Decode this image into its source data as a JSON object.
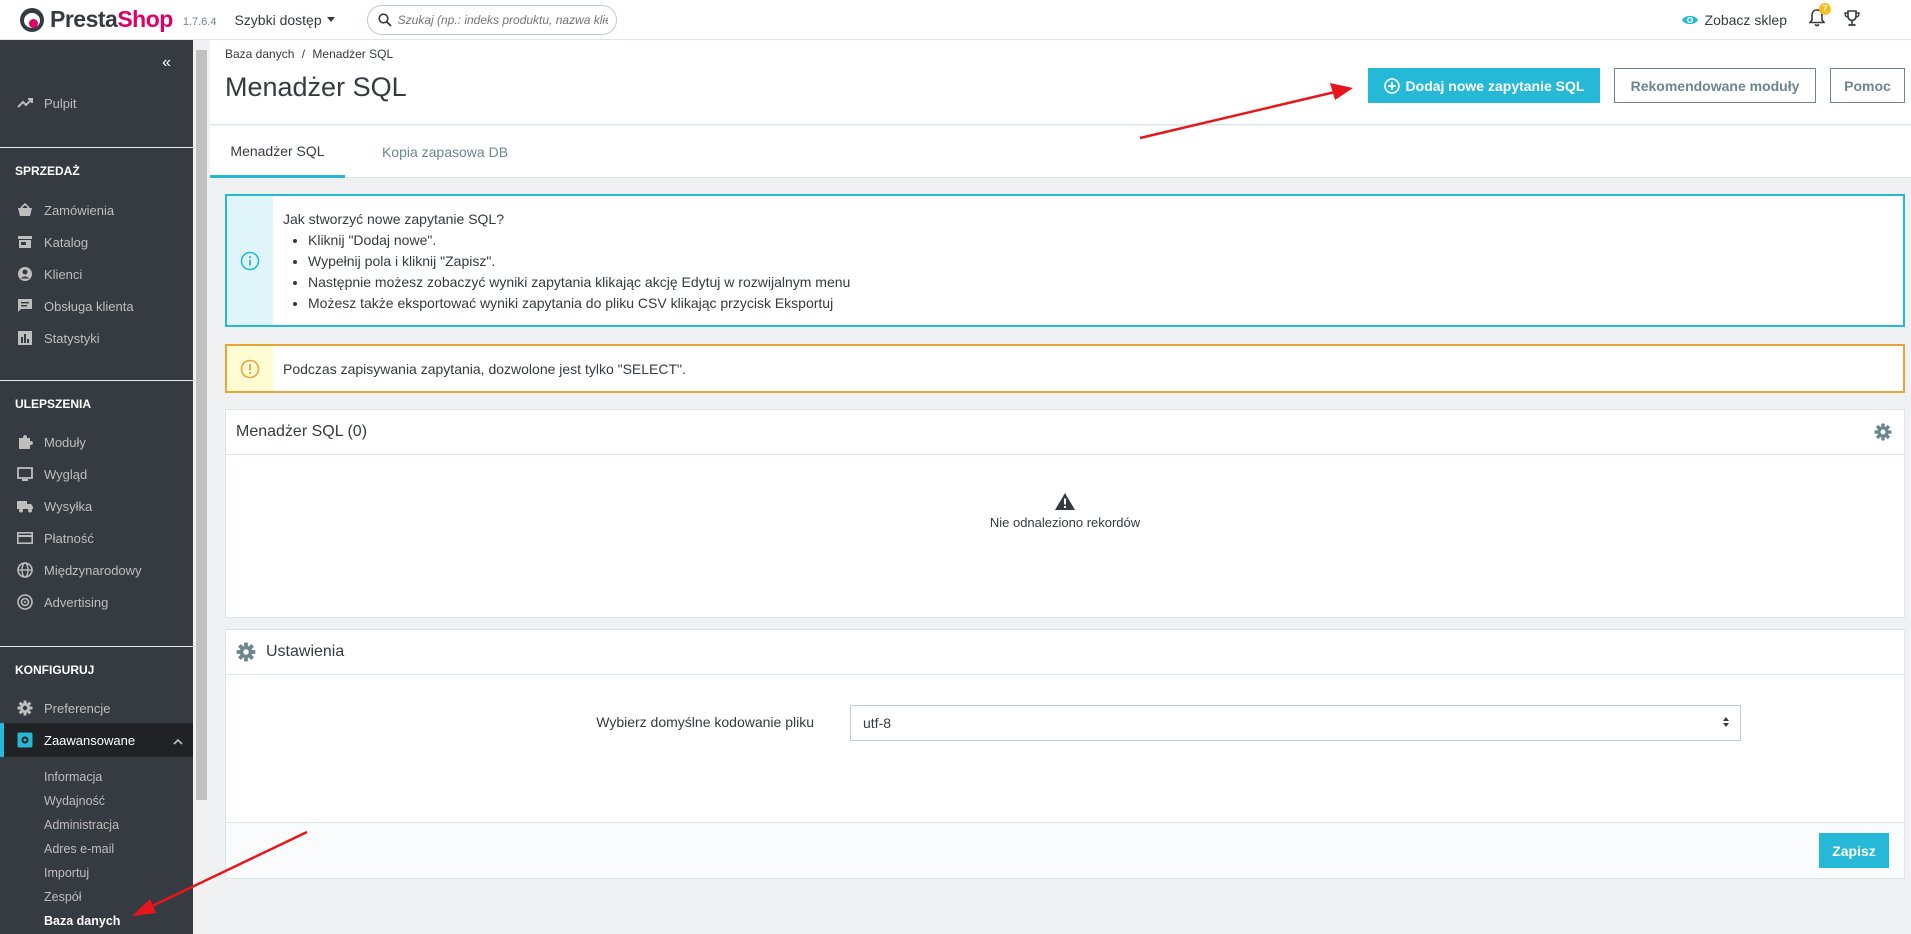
{
  "topbar": {
    "logo_presta": "Presta",
    "logo_shop": "Shop",
    "version": "1.7.6.4",
    "quick_access": "Szybki dostęp",
    "search_placeholder": "Szukaj (np.: indeks produktu, nazwa klie",
    "view_shop": "Zobacz sklep",
    "notification_count": "7"
  },
  "sidebar": {
    "dashboard": "Pulpit",
    "sections": [
      {
        "title": "SPRZEDAŻ",
        "items": [
          "Zamówienia",
          "Katalog",
          "Klienci",
          "Obsługa klienta",
          "Statystyki"
        ]
      },
      {
        "title": "ULEPSZENIA",
        "items": [
          "Moduły",
          "Wygląd",
          "Wysyłka",
          "Płatność",
          "Międzynarodowy",
          "Advertising"
        ]
      },
      {
        "title": "KONFIGURUJ",
        "items": [
          "Preferencje",
          "Zaawansowane"
        ]
      }
    ],
    "subitems": [
      "Informacja",
      "Wydajność",
      "Administracja",
      "Adres e-mail",
      "Importuj",
      "Zespół",
      "Baza danych"
    ]
  },
  "header": {
    "breadcrumb_parent": "Baza danych",
    "breadcrumb_sep": "/",
    "breadcrumb_current": "Menadżer SQL",
    "title": "Menadżer SQL",
    "btn_add": "Dodaj nowe zapytanie SQL",
    "btn_modules": "Rekomendowane moduły",
    "btn_help": "Pomoc"
  },
  "tabs": [
    "Menadżer SQL",
    "Kopia zapasowa DB"
  ],
  "info_alert": {
    "heading": "Jak stworzyć nowe zapytanie SQL?",
    "items": [
      "Kliknij \"Dodaj nowe\".",
      "Wypełnij pola i kliknij \"Zapisz\".",
      "Następnie możesz zobaczyć wyniki zapytania klikając akcję Edytuj w rozwijalnym menu",
      "Możesz także eksportować wyniki zapytania do pliku CSV klikając przycisk Eksportuj"
    ]
  },
  "warning_alert": "Podczas zapisywania zapytania, dozwolone jest tylko \"SELECT\".",
  "list_panel": {
    "title": "Menadżer SQL (0)",
    "empty_text": "Nie odnaleziono rekordów"
  },
  "settings_panel": {
    "title": "Ustawienia",
    "label": "Wybierz domyślne kodowanie pliku",
    "selected": "utf-8",
    "save": "Zapisz"
  },
  "colors": {
    "accent": "#25b9d7",
    "sidebar_bg": "#363a41",
    "warning": "#e5a53b",
    "annotation_arrow": "#e8161b",
    "brand": "#df0067"
  }
}
